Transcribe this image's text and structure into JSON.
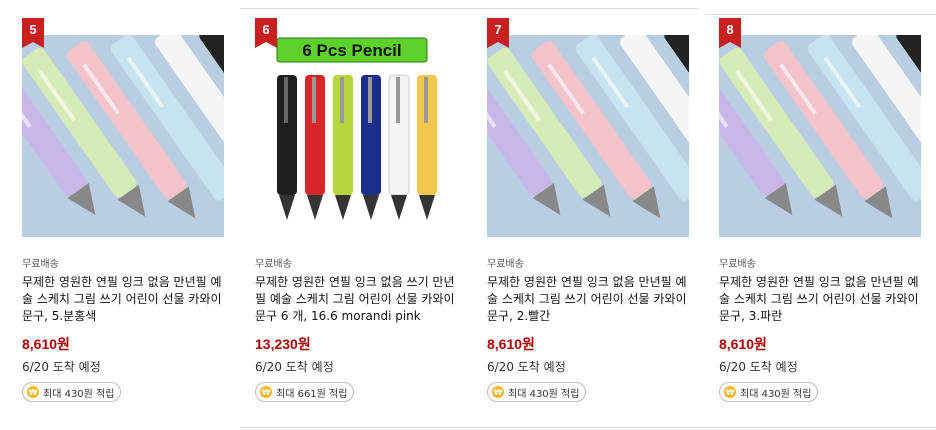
{
  "products": [
    {
      "rank": "5",
      "shipping": "무료배송",
      "title": "무제한 영원한 연필 잉크 없음 만년필 예술 스케치 그림 쓰기 어린이 선물 카와이 문구, 5.분홍색",
      "price": "8,610원",
      "arrival": "6/20 도착 예정",
      "reward": "최대 430원 적립",
      "image": "pastel-pens"
    },
    {
      "rank": "6",
      "shipping": "무료배송",
      "title": "무제한 영원한 연필 잉크 없음 쓰기 만년필 예술 스케치 그림 어린이 선물 카와이 문구 6 개, 16.6 morandi pink",
      "price": "13,230원",
      "arrival": "6/20 도착 예정",
      "reward": "최대 661원 적립",
      "image": "six-pens",
      "image_banner": "6 Pcs Pencil"
    },
    {
      "rank": "7",
      "shipping": "무료배송",
      "title": "무제한 영원한 연필 잉크 없음 만년필 예술 스케치 그림 쓰기 어린이 선물 카와이 문구, 2.빨간",
      "price": "8,610원",
      "arrival": "6/20 도착 예정",
      "reward": "최대 430원 적립",
      "image": "pastel-pens"
    },
    {
      "rank": "8",
      "shipping": "무료배송",
      "title": "무제한 영원한 연필 잉크 없음 만년필 예술 스케치 그림 쓰기 어린이 선물 카와이 문구, 3.파란",
      "price": "8,610원",
      "arrival": "6/20 도착 예정",
      "reward": "최대 430원 적립",
      "image": "pastel-pens"
    }
  ],
  "colors": {
    "rank_badge": "#c81f1f",
    "price": "#ae0000",
    "coin": "#f3b51b"
  },
  "icons": {
    "coin": "coin-icon"
  }
}
